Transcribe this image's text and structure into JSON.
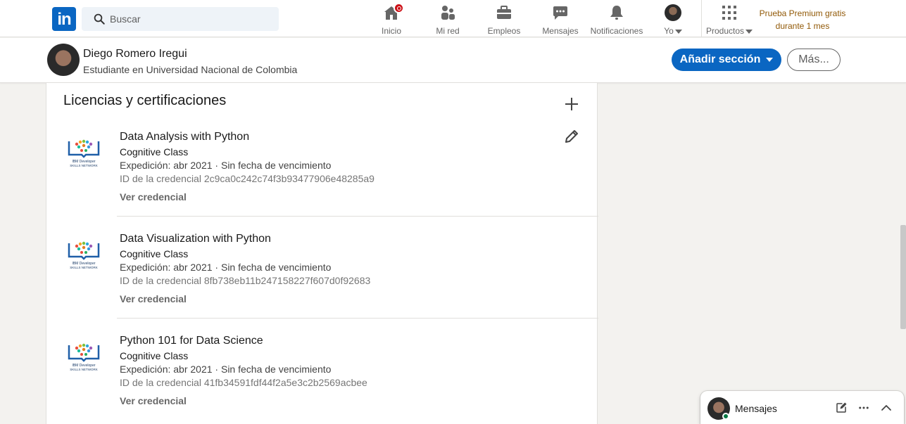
{
  "nav": {
    "search_placeholder": "Buscar",
    "items": [
      {
        "label": "Inicio",
        "icon": "home-icon"
      },
      {
        "label": "Mi red",
        "icon": "network-icon"
      },
      {
        "label": "Empleos",
        "icon": "briefcase-icon"
      },
      {
        "label": "Mensajes",
        "icon": "messaging-icon"
      },
      {
        "label": "Notificaciones",
        "icon": "bell-icon"
      },
      {
        "label": "Yo",
        "icon": "avatar"
      },
      {
        "label": "Productos",
        "icon": "grid-icon"
      }
    ],
    "premium_line1": "Prueba Premium gratis",
    "premium_line2": "durante 1 mes"
  },
  "profile": {
    "name": "Diego Romero Iregui",
    "headline": "Estudiante en Universidad Nacional de Colombia",
    "add_section": "Añadir sección",
    "more": "Más..."
  },
  "section": {
    "title": "Licencias y certificaciones",
    "certs": [
      {
        "title": "Data Analysis with Python",
        "org": "Cognitive Class",
        "date": "Expedición: abr 2021 · Sin fecha de vencimiento",
        "credential": "ID de la credencial 2c9ca0c242c74f3b93477906e48285a9",
        "link": "Ver credencial",
        "logo_text": "IBM Developer SKILLS NETWORK"
      },
      {
        "title": "Data Visualization with Python",
        "org": "Cognitive Class",
        "date": "Expedición: abr 2021 · Sin fecha de vencimiento",
        "credential": "ID de la credencial 8fb738eb11b247158227f607d0f92683",
        "link": "Ver credencial",
        "logo_text": "IBM Developer SKILLS NETWORK"
      },
      {
        "title": "Python 101 for Data Science",
        "org": "Cognitive Class",
        "date": "Expedición: abr 2021 · Sin fecha de vencimiento",
        "credential": "ID de la credencial 41fb34591fdf44f2a5e3c2b2569acbee",
        "link": "Ver credencial",
        "logo_text": "IBM Developer SKILLS NETWORK"
      }
    ]
  },
  "messaging": {
    "label": "Mensajes"
  },
  "colors": {
    "brand": "#0a66c2",
    "premium": "#915907",
    "notification": "#cc1016",
    "online": "#057642"
  }
}
